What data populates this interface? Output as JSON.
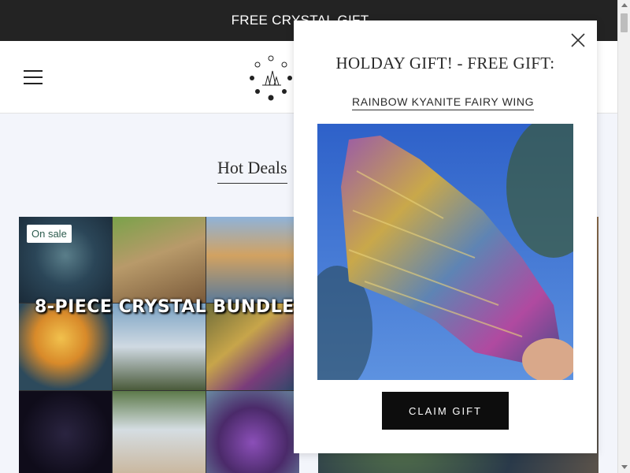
{
  "announcement": {
    "text": "FREE CRYSTAL GIFT →"
  },
  "header": {
    "menu_icon": "hamburger-icon",
    "logo_icon": "crystal-moon-logo-icon"
  },
  "section": {
    "title": "Hot Deals"
  },
  "products": [
    {
      "badge": "On sale",
      "image_text": "8-PIECE CRYSTAL BUNDLE"
    }
  ],
  "popup": {
    "title": "HOLDAY GIFT! - FREE GIFT:",
    "subtitle": "RAINBOW KYANITE FAIRY WING",
    "button_label": "CLAIM GIFT",
    "close_icon": "close-icon"
  },
  "colors": {
    "announcement_bg": "#232323",
    "page_bg": "#f3f5fb",
    "badge_text": "#2d5c4e",
    "button_bg": "#0d0d0d"
  }
}
